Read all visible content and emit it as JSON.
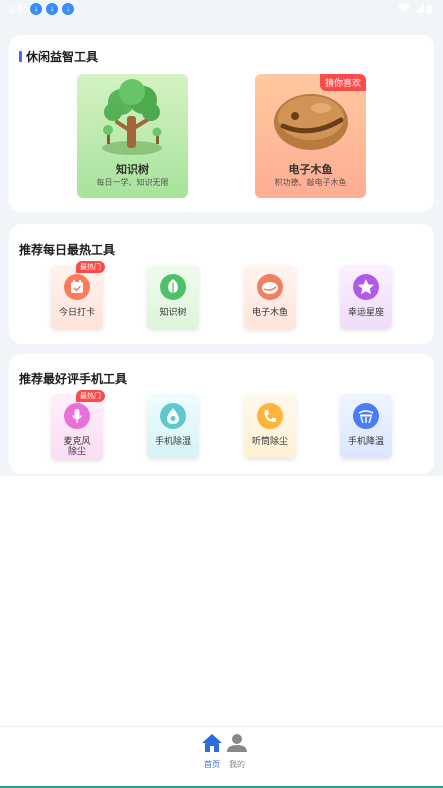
{
  "status_bar": {
    "time": "1:45",
    "downloads": [
      "↓",
      "↓",
      "↓"
    ]
  },
  "section_puzzle": {
    "title": "休闲益智工具",
    "items": [
      {
        "name": "知识树",
        "desc": "每日一学、知识无限",
        "badge": ""
      },
      {
        "name": "电子木鱼",
        "desc": "积功德、敲电子木鱼",
        "badge": "猜你喜欢"
      }
    ]
  },
  "section_daily": {
    "title": "推荐每日最热工具",
    "items": [
      {
        "label": "今日打卡",
        "badge": "最热门",
        "icon": "calendar-check-icon",
        "color": "#ff7a59"
      },
      {
        "label": "知识树",
        "badge": "",
        "icon": "leaf-icon",
        "color": "#4cc16a"
      },
      {
        "label": "电子木鱼",
        "badge": "",
        "icon": "wooden-fish-icon",
        "color": "#f08060"
      },
      {
        "label": "幸运星座",
        "badge": "",
        "icon": "star-icon",
        "color": "#b05be8"
      }
    ]
  },
  "section_phone": {
    "title": "推荐最好评手机工具",
    "items": [
      {
        "label_line1": "麦克风",
        "label_line2": "除尘",
        "badge": "最热门",
        "icon": "microphone-icon",
        "color": "#e870d8"
      },
      {
        "label_line1": "手机除湿",
        "label_line2": "",
        "badge": "",
        "icon": "water-drop-icon",
        "color": "#5cc8cf"
      },
      {
        "label_line1": "听筒除尘",
        "label_line2": "",
        "badge": "",
        "icon": "phone-icon",
        "color": "#ffb43a"
      },
      {
        "label_line1": "手机降温",
        "label_line2": "",
        "badge": "",
        "icon": "cooling-fan-icon",
        "color": "#4a7df5"
      }
    ]
  },
  "bottom_nav": {
    "items": [
      {
        "label": "首页",
        "icon": "home-icon",
        "active": true
      },
      {
        "label": "我的",
        "icon": "person-icon",
        "active": false
      }
    ],
    "active_color": "#2f6bdc",
    "inactive_color": "#888888"
  }
}
